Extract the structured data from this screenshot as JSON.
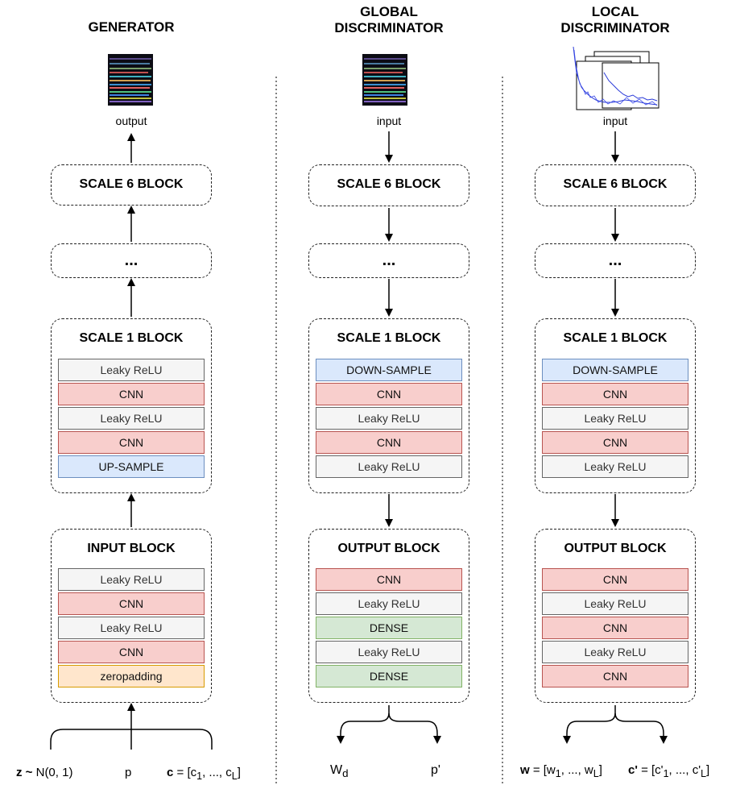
{
  "generator": {
    "title": "GENERATOR",
    "output_caption": "output",
    "scale6": "SCALE 6 BLOCK",
    "ellipsis": "...",
    "scale1": {
      "title": "SCALE 1 BLOCK",
      "layers": [
        {
          "label": "Leaky ReLU",
          "type": "leaky"
        },
        {
          "label": "CNN",
          "type": "cnn"
        },
        {
          "label": "Leaky ReLU",
          "type": "leaky"
        },
        {
          "label": "CNN",
          "type": "cnn"
        },
        {
          "label": "UP-SAMPLE",
          "type": "up"
        }
      ]
    },
    "input_block": {
      "title": "INPUT BLOCK",
      "layers": [
        {
          "label": "Leaky ReLU",
          "type": "leaky"
        },
        {
          "label": "CNN",
          "type": "cnn"
        },
        {
          "label": "Leaky ReLU",
          "type": "leaky"
        },
        {
          "label": "CNN",
          "type": "cnn"
        },
        {
          "label": "zeropadding",
          "type": "zero"
        }
      ]
    },
    "inputs": {
      "z_bold": "z ~",
      "z_rest": " N(0, 1)",
      "p": "p",
      "c_bold": "c",
      "c_rest": " = [c",
      "c_sub1": "1",
      "c_mid": ", ..., c",
      "c_subL": "L",
      "c_end": "]"
    }
  },
  "global_disc": {
    "title_line1": "GLOBAL",
    "title_line2": "DISCRIMINATOR",
    "input_caption": "input",
    "scale6": "SCALE 6 BLOCK",
    "ellipsis": "...",
    "scale1": {
      "title": "SCALE 1 BLOCK",
      "layers": [
        {
          "label": "DOWN-SAMPLE",
          "type": "down"
        },
        {
          "label": "CNN",
          "type": "cnn"
        },
        {
          "label": "Leaky ReLU",
          "type": "leaky"
        },
        {
          "label": "CNN",
          "type": "cnn"
        },
        {
          "label": "Leaky ReLU",
          "type": "leaky"
        }
      ]
    },
    "output_block": {
      "title": "OUTPUT BLOCK",
      "layers": [
        {
          "label": "CNN",
          "type": "cnn"
        },
        {
          "label": "Leaky ReLU",
          "type": "leaky"
        },
        {
          "label": "DENSE",
          "type": "dense"
        },
        {
          "label": "Leaky ReLU",
          "type": "leaky"
        },
        {
          "label": "DENSE",
          "type": "dense"
        }
      ]
    },
    "outputs": {
      "wd": "W",
      "wd_sub": "d",
      "p_prime": "p'"
    }
  },
  "local_disc": {
    "title_line1": "LOCAL",
    "title_line2": "DISCRIMINATOR",
    "input_caption": "input",
    "scale6": "SCALE 6 BLOCK",
    "ellipsis": "...",
    "scale1": {
      "title": "SCALE 1 BLOCK",
      "layers": [
        {
          "label": "DOWN-SAMPLE",
          "type": "down"
        },
        {
          "label": "CNN",
          "type": "cnn"
        },
        {
          "label": "Leaky ReLU",
          "type": "leaky"
        },
        {
          "label": "CNN",
          "type": "cnn"
        },
        {
          "label": "Leaky ReLU",
          "type": "leaky"
        }
      ]
    },
    "output_block": {
      "title": "OUTPUT BLOCK",
      "layers": [
        {
          "label": "CNN",
          "type": "cnn"
        },
        {
          "label": "Leaky ReLU",
          "type": "leaky"
        },
        {
          "label": "CNN",
          "type": "cnn"
        },
        {
          "label": "Leaky ReLU",
          "type": "leaky"
        },
        {
          "label": "CNN",
          "type": "cnn"
        }
      ]
    },
    "outputs": {
      "w_bold": "w",
      "w_rest": " = [w",
      "w_sub1": "1",
      "w_mid": ", ..., w",
      "w_subL": "L",
      "w_end": "]",
      "c_bold": "c'",
      "c_rest": " = [c'",
      "c_sub1": "1",
      "c_mid": ", ..., c'",
      "c_subL": "L",
      "c_end": "]"
    }
  },
  "colors": {
    "leaky": "#f5f5f5",
    "cnn": "#f8cecc",
    "sample": "#dae8fc",
    "dense": "#d5e8d4",
    "zeropadding": "#ffe6cc"
  }
}
